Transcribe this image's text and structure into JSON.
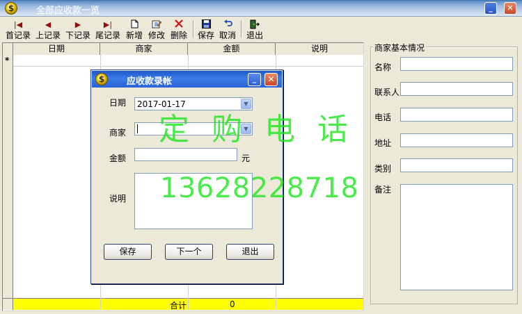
{
  "window": {
    "title": "全部应收款一览",
    "app_icon_glyph": "$",
    "minimize_glyph": "_",
    "close_glyph": "✕"
  },
  "toolbar": {
    "first": {
      "label": "首记录",
      "icon": "first-record-icon"
    },
    "prev": {
      "label": "上记录",
      "icon": "prev-record-icon"
    },
    "next": {
      "label": "下记录",
      "icon": "next-record-icon"
    },
    "last": {
      "label": "尾记录",
      "icon": "last-record-icon"
    },
    "add": {
      "label": "新增",
      "icon": "new-document-icon"
    },
    "edit": {
      "label": "修改",
      "icon": "edit-icon"
    },
    "delete": {
      "label": "删除",
      "icon": "delete-icon"
    },
    "save": {
      "label": "保存",
      "icon": "floppy-icon"
    },
    "cancel": {
      "label": "取消",
      "icon": "undo-icon"
    },
    "exit": {
      "label": "退出",
      "icon": "exit-door-icon"
    }
  },
  "grid": {
    "columns": [
      "日期",
      "商家",
      "金额",
      "说明"
    ],
    "new_row_marker": "*",
    "total_label": "合计",
    "total_value": "0",
    "total_color": "#ffff00"
  },
  "merchant_panel": {
    "title": "商家基本情况",
    "fields": [
      "名称",
      "联系人",
      "电话",
      "地址",
      "类别",
      "备注"
    ]
  },
  "dialog": {
    "title": "应收款录帐",
    "date_label": "日期",
    "date_value": "2017-01-17",
    "merchant_label": "商家",
    "merchant_value": "",
    "amount_label": "金额",
    "amount_value": "",
    "amount_unit": "元",
    "note_label": "说明",
    "note_value": "",
    "buttons": {
      "save": "保存",
      "next": "下一个",
      "exit": "退出"
    }
  },
  "watermark": {
    "line1": "定购电话",
    "line2": "13628228718",
    "color": "#19e619"
  },
  "colors": {
    "background": "#ece9d8",
    "dialog_title": "#2a62d8"
  }
}
